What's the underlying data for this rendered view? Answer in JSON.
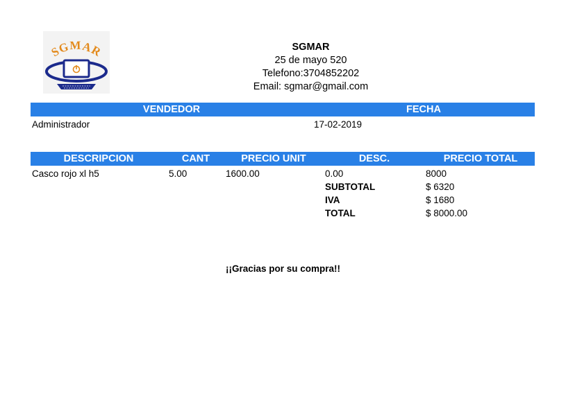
{
  "company": {
    "logo_text": "SGMAR",
    "name": "SGMAR",
    "address": "25 de mayo 520",
    "phone": "Telefono:3704852202",
    "email": "Email: sgmar@gmail.com"
  },
  "header_table": {
    "columns": [
      "VENDEDOR",
      "FECHA"
    ],
    "vendor": "Administrador",
    "date": "17-02-2019"
  },
  "items_table": {
    "columns": [
      "DESCRIPCION",
      "CANT",
      "PRECIO UNIT",
      "DESC.",
      "PRECIO TOTAL"
    ],
    "rows": [
      {
        "descripcion": "Casco rojo xl h5",
        "cant": "5.00",
        "precio_unit": "1600.00",
        "desc": "0.00",
        "precio_total": "8000"
      }
    ]
  },
  "totals": {
    "subtotal_label": "SUBTOTAL",
    "subtotal_value": "$ 6320",
    "iva_label": "IVA",
    "iva_value": "$ 1680",
    "total_label": "TOTAL",
    "total_value": "$ 8000.00"
  },
  "footer": {
    "thanks": "¡¡Gracias por su compra!!"
  },
  "colors": {
    "accent": "#2980e6",
    "logo_orange": "#e38a1c",
    "logo_navy": "#1b2a8c"
  }
}
